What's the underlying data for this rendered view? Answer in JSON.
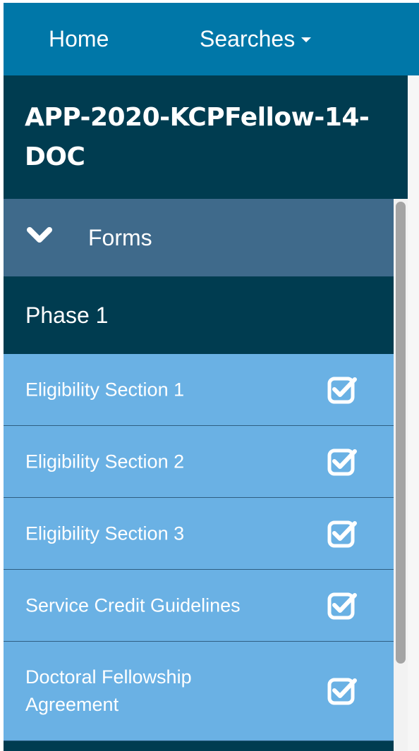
{
  "nav": {
    "home_label": "Home",
    "searches_label": "Searches"
  },
  "sidebar": {
    "app_id": "APP-2020-KCPFellow-14-DOC",
    "forms_label": "Forms",
    "phase_label": "Phase 1",
    "items": [
      {
        "label": "Eligibility Section 1",
        "status_icon": "checked-box-icon"
      },
      {
        "label": "Eligibility Section 2",
        "status_icon": "checked-box-icon"
      },
      {
        "label": "Eligibility Section 3",
        "status_icon": "checked-box-icon"
      },
      {
        "label": "Service Credit Guidelines",
        "status_icon": "checked-box-icon"
      },
      {
        "label": "Doctoral Fellowship Agreement",
        "status_icon": "checked-box-icon"
      }
    ]
  },
  "colors": {
    "navbar": "#0077a8",
    "sidebar_dark": "#003c50",
    "forms_header": "#3f6a8b",
    "item_bg": "#6ab1e4",
    "text": "#ffffff"
  }
}
